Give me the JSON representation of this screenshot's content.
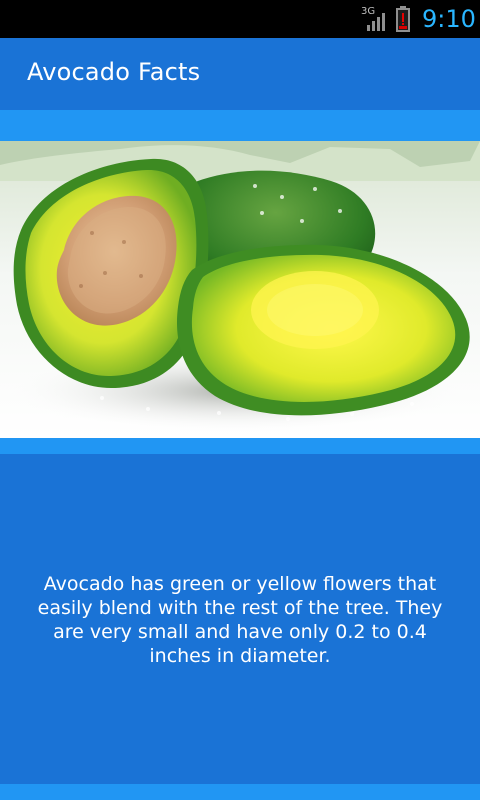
{
  "status_bar": {
    "network_type": "3G",
    "time": "9:10",
    "signal_icon": "signal-strength-icon",
    "battery_icon": "battery-alert-icon"
  },
  "app": {
    "title": "Avocado Facts"
  },
  "image": {
    "subject": "avocado-halves-with-pit",
    "icon": "avocado-photo"
  },
  "fact": {
    "text": "Avocado has green or yellow flowers that easily blend with the rest of the tree. They are very small and have only 0.2 to 0.4 inches in diameter."
  },
  "colors": {
    "primary": "#1a73d6",
    "accent": "#2196f3",
    "status_bar": "#000000",
    "clock": "#2ab6ff"
  }
}
